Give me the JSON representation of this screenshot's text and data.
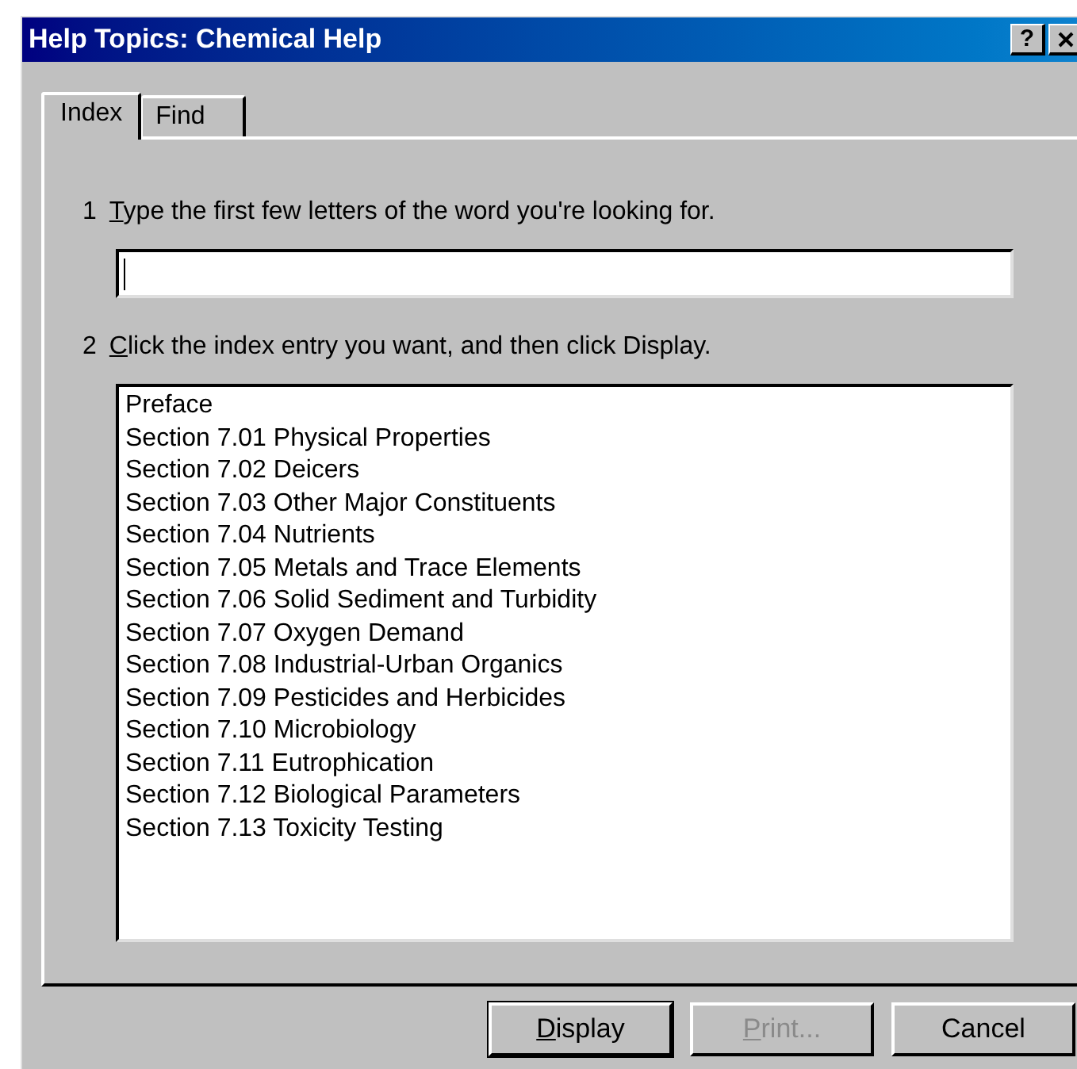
{
  "window": {
    "title": "Help Topics: Chemical Help",
    "help_button": "?"
  },
  "tabs": [
    {
      "label": "Index",
      "selected": true
    },
    {
      "label": "Find",
      "selected": false
    }
  ],
  "step_1": {
    "number": "1",
    "underlined": "T",
    "text": "ype the first few letters of the word you're looking for."
  },
  "step_2": {
    "number": "2",
    "underlined": "C",
    "text": "lick the index entry you want, and then click Display."
  },
  "index_list": [
    "Preface",
    "Section 7.01 Physical Properties",
    "Section 7.02 Deicers",
    "Section 7.03 Other Major Constituents",
    "Section 7.04 Nutrients",
    "Section 7.05 Metals and Trace Elements",
    "Section 7.06 Solid Sediment and Turbidity",
    "Section 7.07 Oxygen Demand",
    "Section 7.08 Industrial-Urban Organics",
    "Section 7.09 Pesticides and Herbicides",
    "Section 7.10 Microbiology",
    "Section 7.11 Eutrophication",
    "Section 7.12 Biological Parameters",
    "Section 7.13 Toxicity Testing"
  ],
  "buttons": [
    {
      "underlined": "D",
      "text": "isplay",
      "disabled": false,
      "default": true
    },
    {
      "underlined": "P",
      "text": "rint...",
      "disabled": true,
      "default": false
    },
    {
      "text": "Cancel",
      "disabled": false,
      "default": false
    }
  ]
}
